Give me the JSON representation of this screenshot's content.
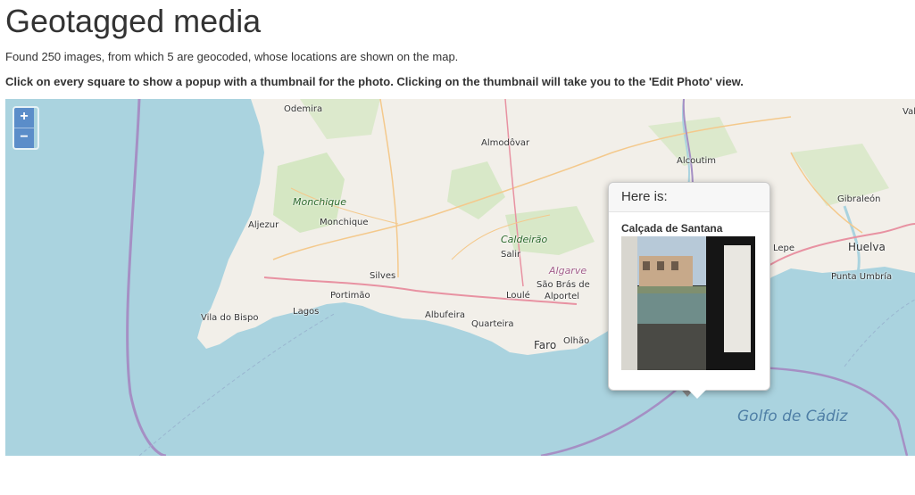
{
  "page": {
    "title": "Geotagged media",
    "summary": "Found 250 images, from which 5 are geocoded, whose locations are shown on the map.",
    "instructions": "Click on every square to show a popup with a thumbnail for the photo. Clicking on the thumbnail will take you to the 'Edit Photo' view."
  },
  "map": {
    "zoom_in": "+",
    "zoom_out": "−",
    "places": {
      "odemira": "Odemira",
      "almodovar": "Almodôvar",
      "alcoutim": "Alcoutim",
      "monchique_region": "Monchique",
      "monchique": "Monchique",
      "aljezur": "Aljezur",
      "caldeirao": "Caldeirão",
      "salir": "Salir",
      "algarve": "Algarve",
      "silves": "Silves",
      "portimao": "Portimão",
      "lagos": "Lagos",
      "vila_do_bispo": "Vila do Bispo",
      "albufeira": "Albufeira",
      "loule": "Loulé",
      "sao_bras_1": "São Brás de",
      "sao_bras_2": "Alportel",
      "quarteira": "Quarteira",
      "faro": "Faro",
      "olhao": "Olhão",
      "lepe": "Lepe",
      "huelva": "Huelva",
      "gibraleon": "Gibraleón",
      "punta_umbria": "Punta Umbría",
      "val": "Val",
      "golfo": "Golfo de Cádiz"
    },
    "colors": {
      "sea": "#aad3df",
      "land": "#f2efe9",
      "forest": "#cde5b9",
      "border": "#a58fc4"
    }
  },
  "popup": {
    "header": "Here is:",
    "photo_name": "Calçada de Santana"
  }
}
